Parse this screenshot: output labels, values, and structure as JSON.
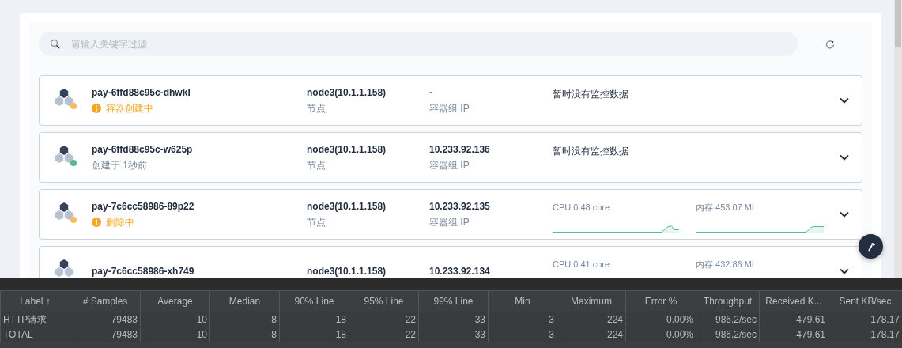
{
  "search": {
    "placeholder": "请输入关键字过滤"
  },
  "pods": [
    {
      "name": "pay-6ffd88c95c-dhwkl",
      "status": {
        "kind": "pending",
        "text": "容器创建中"
      },
      "color": "#f5bc5f",
      "node": "node3(10.1.1.158)",
      "node_label": "节点",
      "ip": "-",
      "ip_label": "容器组 IP",
      "monitor": {
        "kind": "empty",
        "text": "暂时没有监控数据"
      }
    },
    {
      "name": "pay-6ffd88c95c-w625p",
      "status": {
        "kind": "running",
        "text": "创建于 1秒前"
      },
      "color": "#55bc8a",
      "node": "node3(10.1.1.158)",
      "node_label": "节点",
      "ip": "10.233.92.136",
      "ip_label": "容器组 IP",
      "monitor": {
        "kind": "empty",
        "text": "暂时没有监控数据"
      }
    },
    {
      "name": "pay-7c6cc58986-89p22",
      "status": {
        "kind": "pending",
        "text": "删除中"
      },
      "color": "#f5bc5f",
      "node": "node3(10.1.1.158)",
      "node_label": "节点",
      "ip": "10.233.92.135",
      "ip_label": "容器组 IP",
      "monitor": {
        "kind": "metrics",
        "cpu": "CPU 0.48 core",
        "memory": "内存 453.07 Mi",
        "sparkline": true
      }
    },
    {
      "name": "pay-7c6cc58986-xh749",
      "node": "node3(10.1.1.158)",
      "ip": "10.233.92.134",
      "monitor": {
        "kind": "metrics",
        "cpu": "CPU 0.41 core",
        "memory": "内存 432.86 Mi",
        "sparkline": false
      }
    }
  ],
  "report": {
    "columns": [
      "Label ↑",
      "# Samples",
      "Average",
      "Median",
      "90% Line",
      "95% Line",
      "99% Line",
      "Min",
      "Maximum",
      "Error %",
      "Throughput",
      "Received K...",
      "Sent KB/sec"
    ],
    "rows": [
      [
        "HTTP请求",
        "79483",
        "10",
        "8",
        "18",
        "22",
        "33",
        "3",
        "224",
        "0.00%",
        "986.2/sec",
        "479.61",
        "178.17"
      ],
      [
        "TOTAL",
        "79483",
        "10",
        "8",
        "18",
        "22",
        "33",
        "3",
        "224",
        "0.00%",
        "986.2/sec",
        "479.61",
        "178.17"
      ]
    ]
  }
}
